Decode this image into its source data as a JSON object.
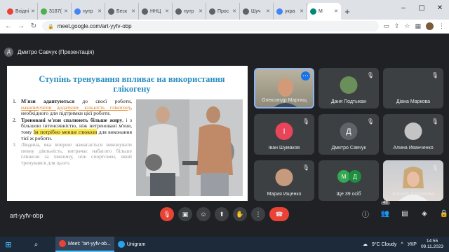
{
  "browser": {
    "tabs": [
      {
        "label": "Вхідні",
        "color": "#ea4335"
      },
      {
        "label": "3187(",
        "color": "#4caf50"
      },
      {
        "label": "нутр",
        "color": "#4285f4"
      },
      {
        "label": "Беск",
        "color": "#5f6368"
      },
      {
        "label": "ННЦ",
        "color": "#5f6368"
      },
      {
        "label": "нутр",
        "color": "#5f6368"
      },
      {
        "label": "Прос",
        "color": "#5f6368"
      },
      {
        "label": "Шуч",
        "color": "#5f6368"
      },
      {
        "label": "укра",
        "color": "#4285f4"
      },
      {
        "label": "M",
        "color": "#00897b",
        "active": true
      }
    ],
    "url": "meet.google.com/art-yyfv-obp"
  },
  "meet": {
    "presenter_initial": "Д",
    "presenter_label": "Дмитро Савчук (Презентація)",
    "meeting_code": "art-yyfv-obp",
    "people_count": "48"
  },
  "slide": {
    "title": "Ступінь тренування впливає на використання глікогену",
    "items": [
      {
        "num": "1.",
        "bold": "М'язи адаптуються",
        "plain1": " до своєї роботи, ",
        "orange": "накопичуючи додаткову кількість глікогену",
        "plain2": ", необхідного для підтримки цієї роботи."
      },
      {
        "num": "2.",
        "bold": "Треновані м'язи спалюють більше жиру",
        "plain1": ", і з більшою інтенсивністю, ніж нетреновані м'язи, тому ",
        "yellow": "їм потрібно менше глюкози",
        "plain2": " для виконання тієї ж роботи."
      },
      {
        "num": "3.",
        "plain": "Людина, яка вперше намагається виконувати певну діяльність, витрачає набагато більше глюкози за хвилину, ніж спортсмен, який тренувався для цього."
      }
    ]
  },
  "participants": [
    {
      "name": "Олександр Мартищ",
      "type": "video"
    },
    {
      "name": "Даня Подтыкан",
      "type": "photo"
    },
    {
      "name": "Діана Маркова",
      "type": "empty"
    },
    {
      "name": "Іван Шумаков",
      "initial": "І",
      "color": "#e8445a"
    },
    {
      "name": "Дмитро Савчук",
      "initial": "Д",
      "color": "#5f6368"
    },
    {
      "name": "Алина Иванченко",
      "type": "photo"
    },
    {
      "name": "Мария Ищенко",
      "type": "photo"
    },
    {
      "name": "Ще 39 осіб",
      "initial_a": "М",
      "initial_b": "Д"
    },
    {
      "name": "Альона Альтанова",
      "type": "video"
    }
  ],
  "taskbar": {
    "apps": [
      {
        "label": "Meet: \"art-yyfv-ob...",
        "color": "#ea4335"
      },
      {
        "label": "Unigram",
        "color": "#2aa3ef"
      }
    ],
    "weather": "9°C Cloudy",
    "lang": "УКР",
    "time": "14:55",
    "date": "09.11.2023"
  }
}
